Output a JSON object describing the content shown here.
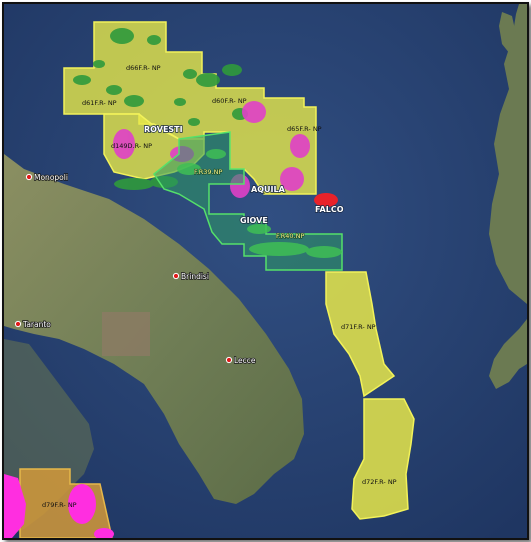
{
  "map": {
    "colors": {
      "sea": "#2b4878",
      "land": "#7b8a5e",
      "permit_fill": "#e7e84a",
      "permit_stroke": "#f2f25a",
      "green_patch": "#2f9a3c",
      "magenta_patch": "#e040c8",
      "research_fill": "#2e9a62",
      "research_stroke": "#55e06a",
      "falco_fill": "#e8222a",
      "city_marker": "#e11b1b"
    },
    "permits": {
      "d66": "d66F.R- NP",
      "d61": "d61F.R- NP",
      "d60": "d60F.R- NP",
      "d65": "d65F.R- NP",
      "d149": "d149D.R- NP",
      "d71": "d71F.R- NP",
      "d72": "d72F.R- NP",
      "d79": "d79F.R- NP"
    },
    "research": {
      "f39": "F.R39.NP",
      "f40": "F.R40.NP"
    },
    "fields": {
      "rovesti": "ROVESTI",
      "aquila": "AQUILA",
      "giove": "GIOVE",
      "falco": "FALCO"
    },
    "cities": {
      "monopoli": "Monopoli",
      "brindisi": "Brindisi",
      "taranto": "Taranto",
      "lecce": "Lecce"
    }
  }
}
